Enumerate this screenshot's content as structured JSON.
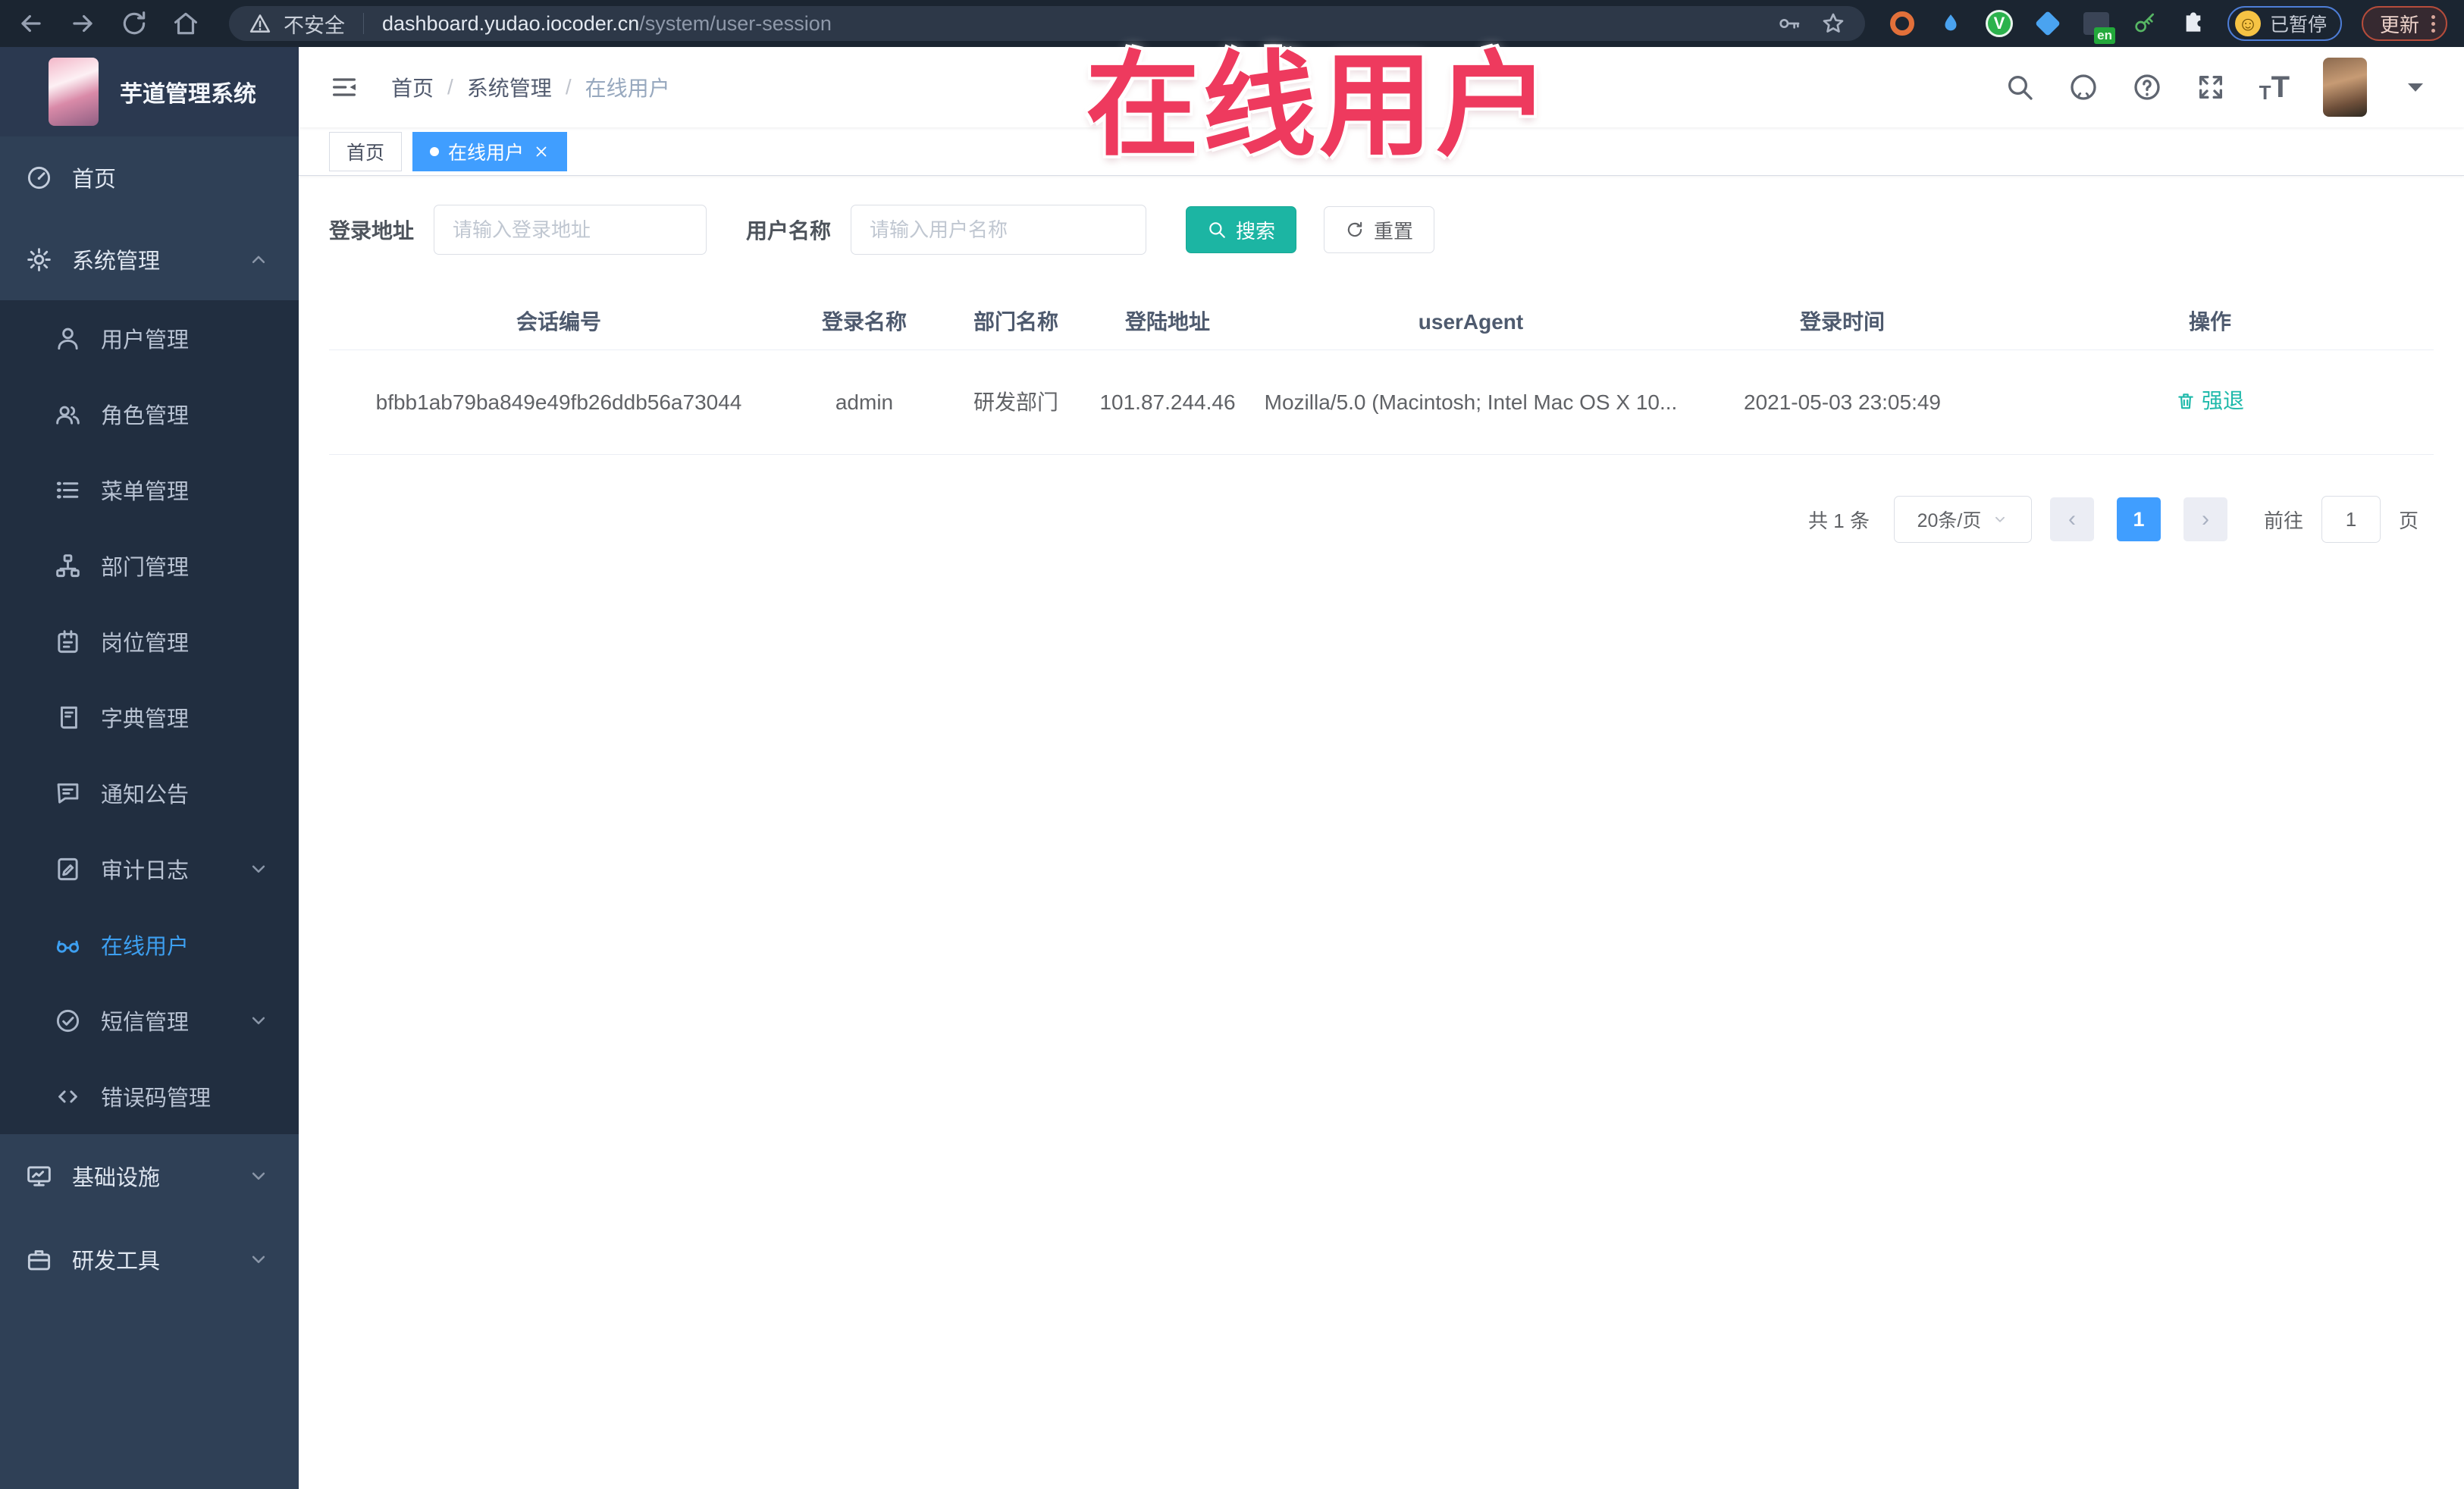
{
  "browser": {
    "security_label": "不安全",
    "url_domain": "dashboard.yudao.iocoder.cn",
    "url_path": "/system/user-session",
    "en_badge": "en",
    "paused_label": "已暂停",
    "update_label": "更新"
  },
  "overlay_text": "在线用户",
  "app": {
    "title": "芋道管理系统",
    "breadcrumb": [
      "首页",
      "系统管理",
      "在线用户"
    ]
  },
  "sidebar": {
    "items": [
      {
        "label": "首页"
      },
      {
        "label": "系统管理"
      },
      {
        "label": "用户管理"
      },
      {
        "label": "角色管理"
      },
      {
        "label": "菜单管理"
      },
      {
        "label": "部门管理"
      },
      {
        "label": "岗位管理"
      },
      {
        "label": "字典管理"
      },
      {
        "label": "通知公告"
      },
      {
        "label": "审计日志"
      },
      {
        "label": "在线用户"
      },
      {
        "label": "短信管理"
      },
      {
        "label": "错误码管理"
      },
      {
        "label": "基础设施"
      },
      {
        "label": "研发工具"
      }
    ]
  },
  "tabs": [
    {
      "label": "首页"
    },
    {
      "label": "在线用户"
    }
  ],
  "filters": {
    "address_label": "登录地址",
    "address_placeholder": "请输入登录地址",
    "name_label": "用户名称",
    "name_placeholder": "请输入用户名称",
    "search_label": "搜索",
    "reset_label": "重置"
  },
  "table": {
    "columns": [
      "会话编号",
      "登录名称",
      "部门名称",
      "登陆地址",
      "userAgent",
      "登录时间",
      "操作"
    ],
    "rows": [
      {
        "session_id": "bfbb1ab79ba849e49fb26ddb56a73044",
        "login_name": "admin",
        "department": "研发部门",
        "login_address": "101.87.244.46",
        "user_agent": "Mozilla/5.0 (Macintosh; Intel Mac OS X 10...",
        "login_time": "2021-05-03 23:05:49",
        "action_label": "强退"
      }
    ]
  },
  "pagination": {
    "total_text": "共 1 条",
    "page_size": "20条/页",
    "current_page": "1",
    "goto_label": "前往",
    "goto_value": "1",
    "page_unit": "页"
  },
  "colors": {
    "primary_blue": "#409eff",
    "teal_accent": "#1cb5a3",
    "overlay_red": "#ee3a5e",
    "sidebar_bg": "#2f4056",
    "submenu_bg": "#212e40",
    "browser_bar_bg": "#1b2531"
  }
}
